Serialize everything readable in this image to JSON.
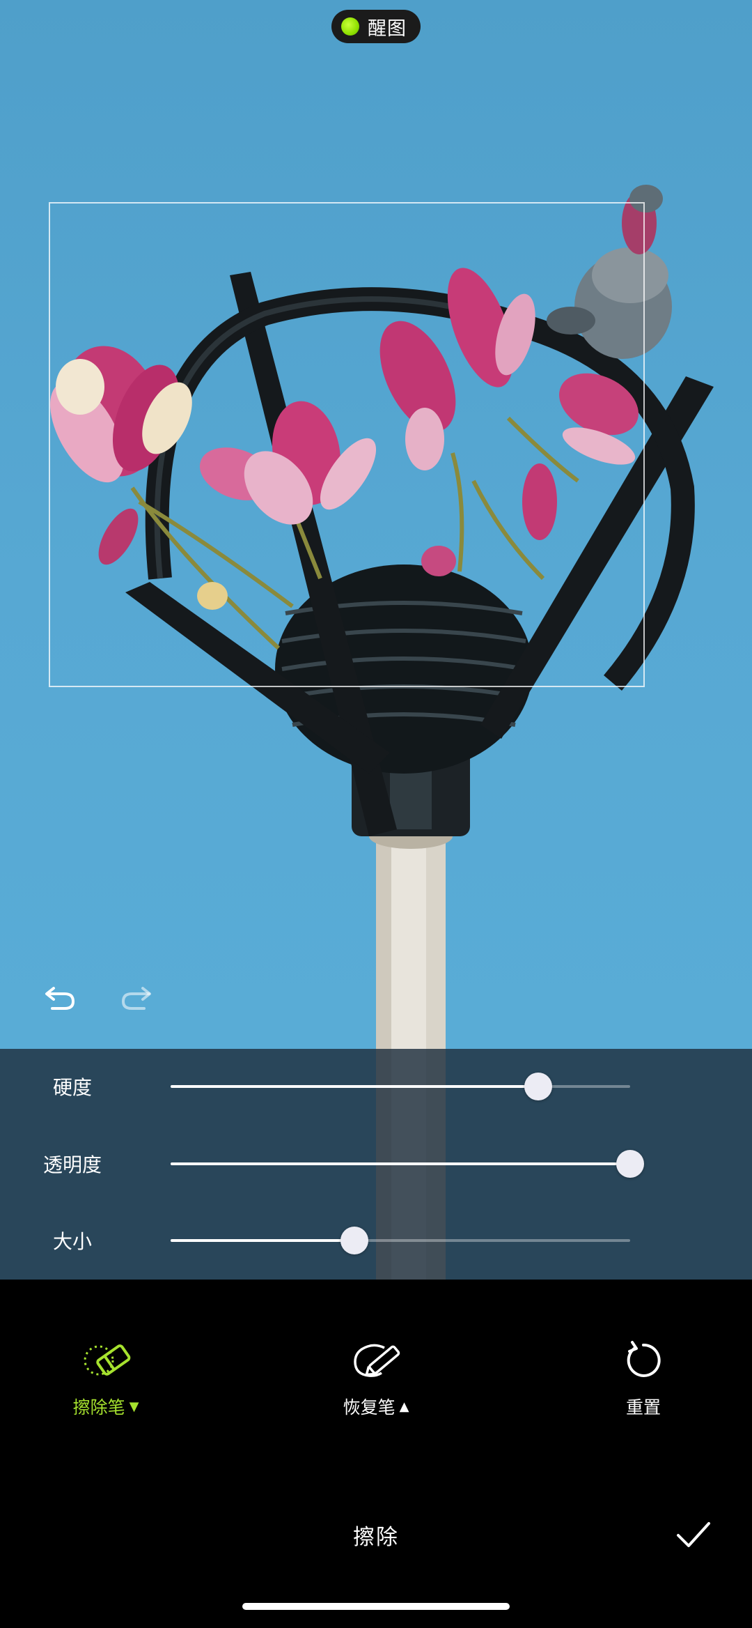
{
  "app_badge": {
    "label": "醒图",
    "icon": "green-dot-icon"
  },
  "history": {
    "undo_icon": "undo-icon",
    "redo_icon": "redo-icon",
    "redo_enabled": false
  },
  "sliders": [
    {
      "id": "hardness",
      "label": "硬度",
      "value": 0.8
    },
    {
      "id": "opacity",
      "label": "透明度",
      "value": 1.0
    },
    {
      "id": "size",
      "label": "大小",
      "value": 0.4
    }
  ],
  "tools": [
    {
      "id": "erase-brush",
      "label": "擦除笔",
      "caret": "▼",
      "icon": "eraser-icon",
      "active": true
    },
    {
      "id": "restore-brush",
      "label": "恢复笔",
      "caret": "▲",
      "icon": "restore-brush-icon",
      "active": false
    },
    {
      "id": "reset",
      "label": "重置",
      "caret": "",
      "icon": "reset-icon",
      "active": false
    }
  ],
  "bottom": {
    "title": "擦除",
    "confirm_icon": "checkmark-icon"
  },
  "colors": {
    "accent": "#a6e22e",
    "sky": "#57a8d3",
    "panel": "#1e303e"
  }
}
